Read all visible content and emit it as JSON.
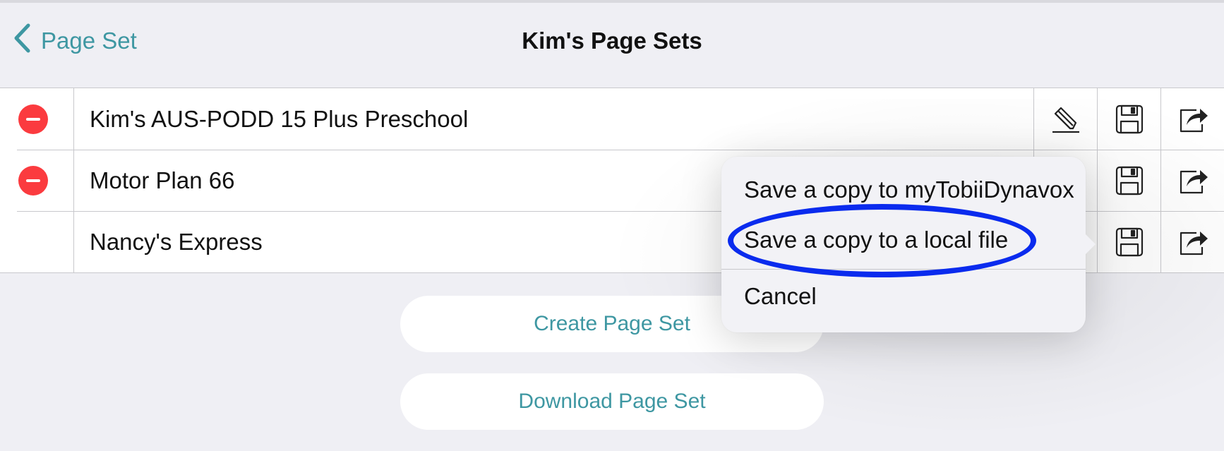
{
  "nav": {
    "back_label": "Page Set",
    "title": "Kim's Page Sets"
  },
  "rows": [
    {
      "name": "Kim's AUS-PODD 15 Plus Preschool",
      "deletable": true
    },
    {
      "name": "Motor Plan 66",
      "deletable": true
    },
    {
      "name": "Nancy's Express",
      "deletable": false
    }
  ],
  "buttons": {
    "create": "Create Page Set",
    "download": "Download Page Set"
  },
  "popover": {
    "items": [
      "Save a copy to myTobiiDynavox",
      "Save a copy to a local file",
      "Cancel"
    ]
  },
  "colors": {
    "accent": "#3e97a2",
    "delete": "#fb3b3f",
    "highlight": "#0a2bee",
    "background": "#efeff4"
  }
}
